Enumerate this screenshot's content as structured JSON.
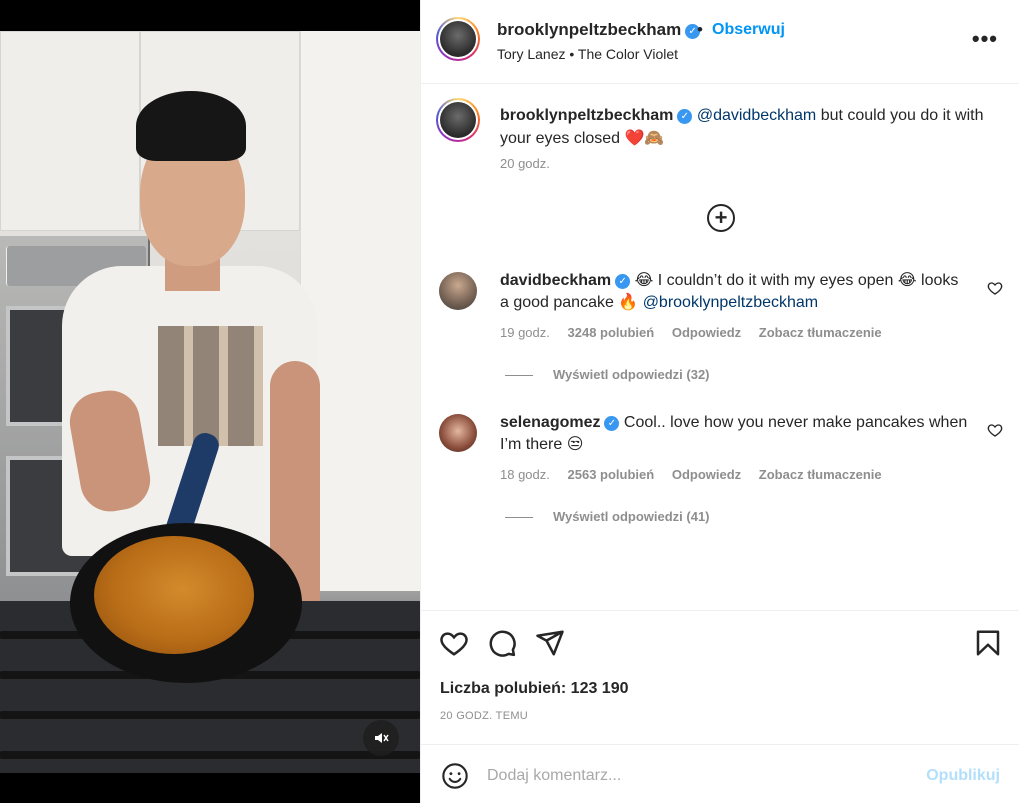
{
  "post": {
    "username": "brooklynpeltzbeckham",
    "follow_label": "Obserwuj",
    "dot": "•",
    "music": "Tory Lanez • The Color Violet",
    "more_label": "•••"
  },
  "caption": {
    "username": "brooklynpeltzbeckham",
    "mention": "@davidbeckham",
    "text": " but could you do it with your eyes closed ❤️🙈",
    "time": "20 godz."
  },
  "load_more_label": "+",
  "comments": [
    {
      "username": "davidbeckham",
      "text_a": " 😂 I couldn’t do it with my eyes open 😂 looks a good pancake 🔥 ",
      "mention": "@brooklynpeltzbeckham",
      "time": "19 godz.",
      "likes": "3248 polubień",
      "reply": "Odpowiedz",
      "translate": "Zobacz tłumaczenie",
      "view_replies": "Wyświetl odpowiedzi (32)"
    },
    {
      "username": "selenagomez",
      "text_a": " Cool.. love how you never make pancakes when I’m there 😒",
      "time": "18 godz.",
      "likes": "2563 polubień",
      "reply": "Odpowiedz",
      "translate": "Zobacz tłumaczenie",
      "view_replies": "Wyświetl odpowiedzi (41)"
    }
  ],
  "actions": {
    "likes_label": "Liczba polubień: 123 190",
    "when": "20 GODZ. TEMU"
  },
  "add_comment": {
    "placeholder": "Dodaj komentarz...",
    "publish_label": "Opublikuj"
  },
  "icons": {
    "verified": "verified-badge-icon",
    "mute": "speaker-muted-icon",
    "heart": "heart-icon",
    "comment": "comment-bubble-icon",
    "share": "paper-plane-icon",
    "save": "bookmark-icon",
    "emoji": "emoji-smiley-icon"
  },
  "colors": {
    "accent": "#0095f6",
    "mention": "#00376b",
    "muted_text": "#8e8e8e",
    "publish_disabled": "#b2dffc"
  }
}
